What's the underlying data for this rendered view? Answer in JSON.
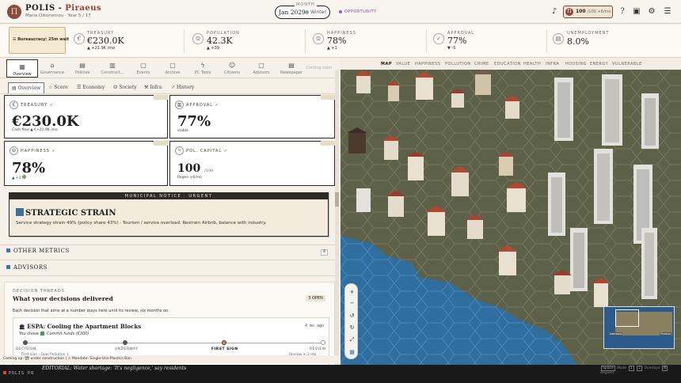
{
  "header": {
    "logo_letter": "Π",
    "game_name": "POLIS -",
    "city": "Piraeus",
    "subtitle": "Maria Oikonomou · Year 5 / 17",
    "month_label": "MONTH",
    "month_value": "Jan 2029",
    "season": "Winter",
    "opportunity": "OPPORTUNITY",
    "pc_badge": "Π",
    "pc_value": "100",
    "pc_detail": "/100 +6/mo",
    "icons": [
      "volume-icon",
      "pc-icon",
      "help-icon",
      "save-icon",
      "settings-icon",
      "menu-icon"
    ]
  },
  "stats": {
    "bureaucracy": "Bureaucracy: 25m wait",
    "items": [
      {
        "label": "TREASURY",
        "value": "€230.0K",
        "delta": "▲ +21.9K /mo",
        "icon": "€"
      },
      {
        "label": "POPULATION",
        "value": "42.3K",
        "delta": "▲ +39",
        "icon": "☺"
      },
      {
        "label": "HAPPINESS",
        "value": "78%",
        "delta": "▲ +1",
        "icon": "☺"
      },
      {
        "label": "APPROVAL",
        "value": "77%",
        "delta": "▼ -5",
        "icon": "✓"
      },
      {
        "label": "UNEMPLOYMENT",
        "value": "8.0%",
        "delta": "",
        "icon": "▤"
      }
    ]
  },
  "nav": {
    "items": [
      "Overview",
      "Governance",
      "Policies",
      "Construct...",
      "Events",
      "Archive",
      "PC Tools",
      "Citizens",
      "Advisors",
      "Newspaper"
    ],
    "icons": [
      "▦",
      "⌂",
      "▤",
      "▥",
      "▢",
      "▢",
      "ϟ",
      "☺",
      "▢",
      "▤"
    ],
    "coming": "Coming soon"
  },
  "subtabs": [
    "Overview",
    "Score",
    "Economy",
    "Society",
    "Infra",
    "History"
  ],
  "cards": {
    "treasury": {
      "label": "TREASURY",
      "value": "€230.0K",
      "sub": "Cash flow  ▲ €+21.9K /mo"
    },
    "approval": {
      "label": "APPROVAL",
      "value": "77%",
      "sub": "stable"
    },
    "happiness": {
      "label": "HAPPINESS",
      "value": "78%",
      "sub": "▲ +1"
    },
    "pol_capital": {
      "label": "POL. CAPITAL",
      "value": "100",
      "unit": "/100",
      "sub": "Regen +6/mo"
    }
  },
  "notice": {
    "head": "MUNICIPAL NOTICE · URGENT",
    "title": "STRATEGIC STRAIN",
    "body": "Service strategy strain 49% (policy share 43%) · Tourism / service overload. Restrain Airbnb, balance with industry."
  },
  "sections": {
    "other_metrics": "OTHER METRICS",
    "other_count": "8",
    "advisors": "ADVISORS"
  },
  "decisions": {
    "kicker": "DECISION THREADS",
    "title": "What your decisions delivered",
    "open": "3 OPEN",
    "desc": "Each decision that aims at a number stays here until its review, six months on.",
    "thread": {
      "title": "ESPA: Cooling the Apartment Blocks",
      "date": "4 mo ago",
      "chose_prefix": "You chose",
      "chose_value": "Commit funds (€300)",
      "stages": [
        "DECISION",
        "UNDERWAY",
        "FIRST SIGN",
        "REVIEW"
      ],
      "decision_detail": "First sign · Goal Pollution ↓",
      "review_detail": "Review in 2 mo"
    }
  },
  "map": {
    "tabs": [
      "MAP",
      "VALUE",
      "HAPPINESS",
      "POLLUTION",
      "CRIME",
      "EDUCATION",
      "HEALTH",
      "INFRA",
      "HOUSING",
      "ENERGY",
      "VULNERABLE"
    ],
    "zoom": [
      "+",
      "−",
      "↺",
      "↻",
      "⤢",
      "▦"
    ],
    "minimap_labels": [
      "Lemesos",
      "Piraeus"
    ]
  },
  "ticker": "Coming up: 🏗 under construction | ⚠ Mandate: Single-Use Plastics Ban",
  "statusbar": {
    "brand": "POLIS PR",
    "news": "EDITORIAL: Water shortage: 'It's negligence,' say residents",
    "keys_prefix": "Space",
    "keys_labels": [
      "Mode",
      "1",
      "2",
      "Overlays",
      "N",
      "Regions"
    ]
  },
  "colors": {
    "accent": "#9b3b2f",
    "ink": "#1f1f1f",
    "paper": "#f5f1e8",
    "sea": "#2f6e9e",
    "link": "#3f73b8"
  }
}
